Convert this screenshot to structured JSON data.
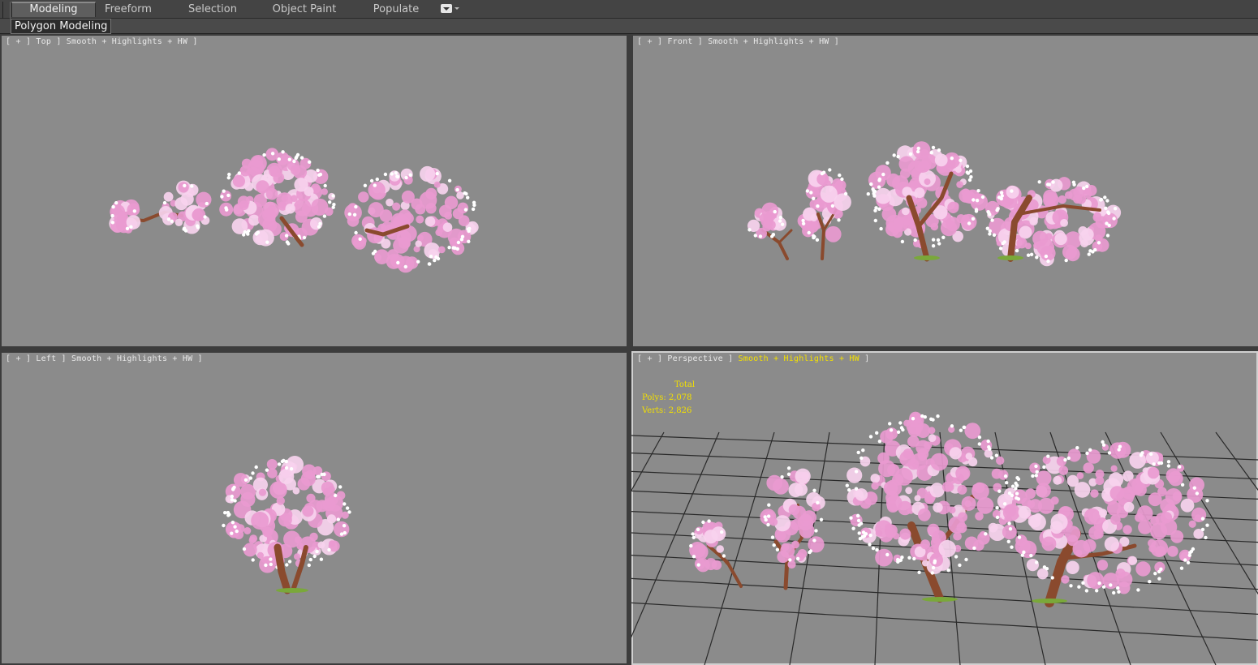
{
  "ribbon": {
    "tabs": [
      {
        "label": "Modeling",
        "active": true
      },
      {
        "label": "Freeform",
        "active": false
      },
      {
        "label": "Selection",
        "active": false
      },
      {
        "label": "Object Paint",
        "active": false
      },
      {
        "label": "Populate",
        "active": false
      }
    ],
    "panel_label": "Polygon Modeling",
    "dropdown_icon": "dropdown-menu-icon"
  },
  "viewports": {
    "top": {
      "bracket_open": "[",
      "plus": "+",
      "sep1": "]",
      "name": "Top",
      "sep2": "]",
      "shading": "Smooth + Highlights + HW",
      "bracket_close": "]"
    },
    "front": {
      "bracket_open": "[",
      "plus": "+",
      "sep1": "]",
      "name": "Front",
      "sep2": "]",
      "shading": "Smooth + Highlights + HW",
      "bracket_close": "]"
    },
    "left": {
      "bracket_open": "[",
      "plus": "+",
      "sep1": "]",
      "name": "Left",
      "sep2": "]",
      "shading": "Smooth + Highlights + HW",
      "bracket_close": "]"
    },
    "perspective": {
      "bracket_open": "[",
      "plus": "+",
      "sep1": "]",
      "name": "Perspective",
      "sep2": "]",
      "shading": "Smooth + Highlights + HW",
      "bracket_close": "]"
    }
  },
  "stats": {
    "header": "Total",
    "polys_label": "Polys:",
    "polys_value": "2,078",
    "verts_label": "Verts:",
    "verts_value": "2,826"
  },
  "colors": {
    "viewport_bg": "#8b8b8b",
    "blossom": "#e99ad0",
    "blossom_light": "#f7d2ee",
    "trunk": "#8a4a2e",
    "grass": "#7aa83a",
    "grid": "#2a2a2a",
    "highlight_text": "#f3e000"
  }
}
